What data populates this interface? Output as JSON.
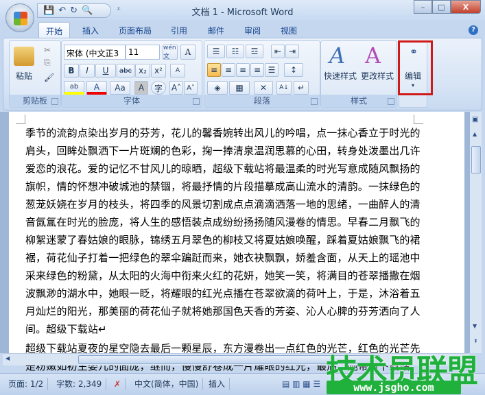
{
  "window": {
    "title": "文档 1 - Microsoft Word",
    "minimize": "–",
    "maximize": "□",
    "close": "X"
  },
  "quick_access": {
    "save": "💾",
    "undo": "↶",
    "redo": "↻",
    "preview": "🔍",
    "more": "⩡"
  },
  "tabs": [
    {
      "label": "开始",
      "active": true
    },
    {
      "label": "插入"
    },
    {
      "label": "页面布局"
    },
    {
      "label": "引用"
    },
    {
      "label": "邮件"
    },
    {
      "label": "审阅"
    },
    {
      "label": "视图"
    }
  ],
  "help": "?",
  "ribbon": {
    "clipboard": {
      "label": "剪贴板",
      "paste": "粘贴",
      "cut": "✂",
      "copy": "⎘",
      "format_painter": "🖌"
    },
    "font": {
      "label": "字体",
      "font_name": "宋体 (中文正3",
      "font_size": "11",
      "phonetic": "wén\n文",
      "char_border": "A",
      "bold": "B",
      "italic": "I",
      "underline": "U",
      "strike": "abc",
      "subscript": "x₂",
      "superscript": "x²",
      "clear": "A",
      "highlight": "ab",
      "font_color": "A",
      "change_case": "Aa",
      "char_shade": "A",
      "enclose": "字",
      "grow": "A˄",
      "shrink": "A˅"
    },
    "paragraph": {
      "label": "段落",
      "bullets": "☰",
      "numbering": "☷",
      "multilevel": "☲",
      "dec_indent": "⇤",
      "inc_indent": "⇥",
      "align_left": "≡",
      "center": "≡",
      "align_right": "≡",
      "justify": "≡",
      "distributed": "☰",
      "line_spacing": "↕",
      "shading": "◈",
      "borders": "▦",
      "chinese_layout": "✕",
      "sort": "A↓",
      "show_marks": "↵"
    },
    "styles": {
      "label": "样式",
      "quick_styles": "快速样式",
      "change_styles": "更改样式"
    },
    "editing": {
      "label": "编辑",
      "icon": "binoculars"
    }
  },
  "highlight_color": "#d01a1a",
  "document": {
    "lines": [
      "季节的流韵点染出岁月的芬芳，花儿的馨香婉转出风儿的吟唱，点一抹心香立于时光的",
      "肩头，回眸处飘洒下一片斑斓的色彩，掬一捧清泉温润思慕的心田，转身处泼墨出几许",
      "爱恋的浪花。爱的记忆不甘风儿的晾晒，超级下载站将最温柔的时光写意成随风飘扬的",
      "旗帜，情的怀想冲破城池的禁锢，将最抒情的片段描摹成高山流水的清韵。一抹绿色的",
      "葱茏妖娆在岁月的枝头，将四季的风景切割成点点滴滴洒落一地的思绪，一曲醉人的清",
      "音氤氲在时光的脸庞，将人生的感悟装点成纷纷扬扬随风漫卷的情思。早春二月飘飞的",
      "柳絮迷蒙了春姑娘的眼脉，锦绣五月翠色的柳枝又将夏姑娘唤醒，踩着夏姑娘飘飞的裙",
      "裾，荷花仙子打着一把绿色的翠伞蹁跹而来，她衣袂飘飘，娇羞含面，从天上的瑶池中",
      "采来绿色的粉黛，从太阳的火海中衔来火红的花妍，她笑一笑，将满目的苍翠播撒在烟",
      "波飘渺的湖水中，她眼一眨，将耀眼的红光点播在苍翠欲滴的荷叶上，于是，沐浴着五",
      "月灿烂的阳光，那美丽的荷花仙子就将她那国色天香的芳姿、沁人心脾的芬芳洒向了人",
      "间。超级下载站↵",
      "超级下载站夏夜的星空隐去最后一颗星辰，东方漫卷出一点红色的光芒，红色的光芒先",
      "是粉嫩如初生婴儿的面庞，继而，慢慢舒卷成一片耀眼的红光，最后，她带着下载站"
    ]
  },
  "status": {
    "page": "页面: 1/2",
    "words": "字数: 2,349",
    "language": "中文(简体，中国)",
    "mode": "插入"
  },
  "watermark": {
    "text": "技术员联盟",
    "url": "www.jsgho.com"
  }
}
